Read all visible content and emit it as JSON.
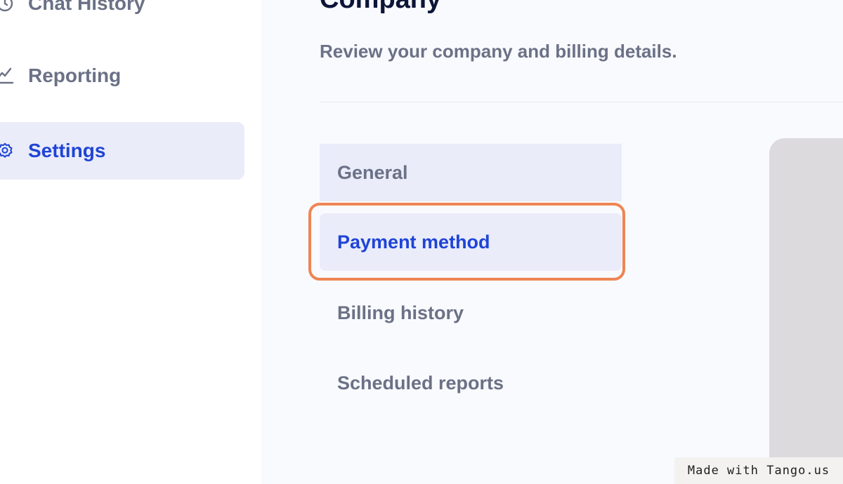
{
  "sidebar": {
    "items": [
      {
        "label": "Chat History",
        "icon": "chat-history-icon",
        "active": false
      },
      {
        "label": "Reporting",
        "icon": "chart-line-icon",
        "active": false
      },
      {
        "label": "Settings",
        "icon": "gear-icon",
        "active": true
      }
    ]
  },
  "main": {
    "title": "Company",
    "subtitle": "Review your company and billing details.",
    "tabs": [
      {
        "label": "General",
        "active": false
      },
      {
        "label": "Payment method",
        "active": true
      },
      {
        "label": "Billing history",
        "active": false
      },
      {
        "label": "Scheduled reports",
        "active": false
      }
    ]
  },
  "watermark": {
    "text": "Made with Tango.us"
  },
  "colors": {
    "accent": "#1f44d6",
    "active_bg": "#eaecfa",
    "highlight": "#ee8554",
    "title": "#0d1537",
    "muted_text": "#6b7186"
  }
}
